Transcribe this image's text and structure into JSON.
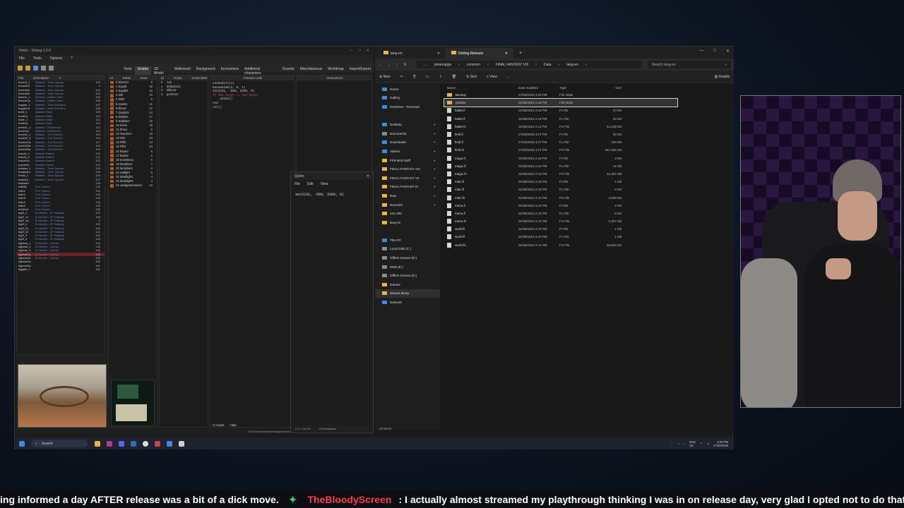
{
  "debug": {
    "title": "Hotch - Debug 1.0.0",
    "menu": [
      "File",
      "Tools",
      "Options",
      "?"
    ],
    "tabs": [
      "Texts",
      "Scripts",
      "3D Model",
      "Walkmesh",
      "Background",
      "Encounters",
      "Additional characters",
      "Sounds",
      "Miscellaneous",
      "Worldmap",
      "Import/Export"
    ],
    "files_header": [
      "File",
      "Description",
      "#"
    ],
    "files": [
      [
        "bccent_1",
        "Balamb - Town Square",
        "102"
      ],
      [
        "bccent12",
        "Balamb - Town Square",
        "0"
      ],
      [
        "bccent1a",
        "Balamb - Town Square",
        "104"
      ],
      [
        "bccent1b",
        "Balamb - Town Square",
        "103"
      ],
      [
        "bcform_1",
        "Balamb - Station Yard",
        "105"
      ],
      [
        "bcform1a",
        "Balamb - Station Yard",
        "106"
      ],
      [
        "bcgate_1",
        "Balamb - Town Entrance",
        "107"
      ],
      [
        "bcgate1a",
        "Balamb - Town Entrance",
        "108"
      ],
      [
        "bchtl_1",
        "Balamb Hotel",
        "109"
      ],
      [
        "bchtl1a",
        "Balamb Hotel",
        "110"
      ],
      [
        "bchtr_1",
        "Balamb Hotel",
        "111"
      ],
      [
        "bchtr1a",
        "Balamb Hotel",
        "112"
      ],
      [
        "bcmin1_1",
        "Balamb - Residence",
        "113"
      ],
      [
        "bcmin1a",
        "Balamb - Residence",
        "114"
      ],
      [
        "bcmin2_1",
        "Balamb - The Dincht's",
        "115"
      ],
      [
        "bcmin2_3",
        "Balamb - The Dincht's",
        "116"
      ],
      [
        "bcmin21a",
        "Balamb - The Dincht's",
        "117"
      ],
      [
        "bcmin22a",
        "Balamb - The Dincht's",
        "118"
      ],
      [
        "bcmin23a",
        "Balamb - The Dincht's",
        "119"
      ],
      [
        "bcport_1",
        "Balamb Harbor",
        "120"
      ],
      [
        "bcport_2",
        "Balamb Harbor",
        "121"
      ],
      [
        "bcport1a",
        "Balamb Harbor",
        "122"
      ],
      [
        "bcport1b",
        "Balamb Harbor",
        "123"
      ],
      [
        "bcsaka_1",
        "Balamb - Town Square",
        "124"
      ],
      [
        "bcsaka1a",
        "Balamb - Town Square",
        "125"
      ],
      [
        "bcsta_1",
        "Balamb - Town Square",
        "126"
      ],
      [
        "bcsta1a",
        "Balamb - Town Square",
        "127"
      ],
      [
        "bdenter1",
        "",
        "128"
      ],
      [
        "bdifrit1",
        "Fire Cavern",
        "130"
      ],
      [
        "bdin1",
        "Fire Cavern",
        "131"
      ],
      [
        "bdin2",
        "Fire Cavern",
        "132"
      ],
      [
        "bdin3",
        "Fire Cavern",
        "133"
      ],
      [
        "bdin4",
        "Fire Cavern",
        "134"
      ],
      [
        "bdin5",
        "Fire Cavern",
        "135"
      ],
      [
        "bdview1",
        "Fire Cavern",
        "136"
      ],
      [
        "bg2f_1",
        "B-Garden - 2F Hallway",
        "137"
      ],
      [
        "bg2f_11",
        "B-Garden - 2F Hallway",
        "138"
      ],
      [
        "bg2f_1a",
        "B-Garden - 2F Hallway",
        "0"
      ],
      [
        "bg2f_2",
        "B-Garden - 2F Hallway",
        "139"
      ],
      [
        "bg2f_21",
        "B-Garden - 2F Hallway",
        "140"
      ],
      [
        "bg2f_22",
        "B-Garden - 2F Hallway",
        "141"
      ],
      [
        "bg2f_3",
        "B-Garden - 2F Hallway",
        "142"
      ],
      [
        "bg2f_4",
        "B-Garden - 2F Hallway",
        "143"
      ],
      [
        "bgbook_1",
        "B-Garden - Library",
        "144"
      ],
      [
        "bgbook_2",
        "B-Garden - Library",
        "145"
      ],
      [
        "bgbook_3",
        "B-Garden - Library",
        "146"
      ],
      [
        "bgbook1a",
        "B-Garden - Library",
        "148"
      ],
      [
        "bgbook1b",
        "B-Garden - Library",
        "149"
      ],
      [
        "bgbook2a",
        "",
        "150"
      ],
      [
        "bgbook3a",
        "",
        "151"
      ],
      [
        "bggate_1",
        "",
        "152"
      ]
    ],
    "selected_file": 46,
    "entities_header": [
      "Id",
      "Entity",
      "Exec"
    ],
    "entities": [
      [
        "0",
        "Director",
        "6"
      ],
      [
        "1",
        "Squall",
        "18"
      ],
      [
        "2",
        "Squall2",
        "12"
      ],
      [
        "3",
        "Zell",
        "10"
      ],
      [
        "4",
        "Zell2",
        "6"
      ],
      [
        "5",
        "Quistis",
        "11"
      ],
      [
        "6",
        "Rinoa",
        "12"
      ],
      [
        "7",
        "Quistis2",
        "14"
      ],
      [
        "8",
        "Selphie",
        "17"
      ],
      [
        "9",
        "Selphie2",
        "15"
      ],
      [
        "10",
        "Irvine",
        "16"
      ],
      [
        "11",
        "Shiva",
        "8"
      ],
      [
        "12",
        "Teacher1",
        "10"
      ],
      [
        "13",
        "Sho",
        "10"
      ],
      [
        "14",
        "Pl00",
        "14"
      ],
      [
        "15",
        "Pl02",
        "10"
      ],
      [
        "16",
        "Book2",
        "6"
      ],
      [
        "17",
        "Book3",
        "6"
      ],
      [
        "18",
        "Eventline1",
        "6"
      ],
      [
        "19",
        "lampline1",
        "7"
      ],
      [
        "20",
        "lampline2",
        "4"
      ],
      [
        "21",
        "wallight",
        "6"
      ],
      [
        "22",
        "desklight1",
        "4"
      ],
      [
        "23",
        "desklight2",
        "4"
      ],
      [
        "24",
        "cardgamemaster",
        "10"
      ]
    ],
    "scripts_header": [
      "Id",
      "Script",
      "Script label"
    ],
    "scripts": [
      [
        "0",
        "",
        "140"
      ],
      [
        "1",
        "default",
        "141"
      ],
      [
        "2",
        "talk",
        "142"
      ],
      [
        "3",
        "push",
        "143"
      ]
    ],
    "pseudo_label": "Pseudo-code",
    "instr_label": "Instructions",
    "code_lines": [
      "setmodel(11)",
      "baseanime(2, 0, 1)",
      "set3(81, -960, 3369, 0)",
      "if 354_count == 414 begin",
      "    unuse()",
      "end",
      "ret()"
    ],
    "compile_label": "Compile",
    "help_label": "Help",
    "path": "D:\\SteamLibrary\\steamapps\\common\\FINAL FANTASY VIII\\Data\\lang-en\\field.fs"
  },
  "quine": {
    "title": "Quine",
    "menu": [
      "File",
      "Edit",
      "View"
    ],
    "code": "set3(81, -960, 3369, 0)",
    "status_pos": "Ln 1, Col 24",
    "status_chars": "23 characters"
  },
  "explorer": {
    "tabs": [
      "lang-en",
      "Delling-Release"
    ],
    "crumbs": [
      "steamapps",
      "common",
      "FINAL FANTASY VIII",
      "Data",
      "lang-en"
    ],
    "search_placeholder": "Search lang-en",
    "commands": [
      "New",
      "Sort",
      "View",
      "Details"
    ],
    "nav": [
      {
        "label": "Home",
        "icon": "home"
      },
      {
        "label": "Gallery",
        "icon": "gallery"
      },
      {
        "label": "OneDrive - Personal",
        "icon": "cloud"
      },
      {
        "label": "",
        "icon": ""
      },
      {
        "label": "Desktop",
        "icon": "blue",
        "pin": true
      },
      {
        "label": "Documents",
        "icon": "gray",
        "pin": true
      },
      {
        "label": "Downloads",
        "icon": "blue",
        "pin": true
      },
      {
        "label": "Videos",
        "icon": "blue",
        "pin": true
      },
      {
        "label": "FF8 Mod Stuff",
        "icon": "folder",
        "pin": true
      },
      {
        "label": "FINAL FANTASY VIII",
        "icon": "folder",
        "pin": true
      },
      {
        "label": "FINAL FANTASY VII",
        "icon": "folder",
        "pin": true
      },
      {
        "label": "FINAL FANTASY IX",
        "icon": "folder",
        "pin": true
      },
      {
        "label": "Raw",
        "icon": "folder",
        "pin": true
      },
      {
        "label": "Necrosis",
        "icon": "folder",
        "pin": true
      },
      {
        "label": "101-200",
        "icon": "folder"
      },
      {
        "label": "lang-en",
        "icon": "folder"
      },
      {
        "label": "",
        "icon": ""
      },
      {
        "label": "This PC",
        "icon": "blue"
      },
      {
        "label": "Local Disk (C:)",
        "icon": "gray"
      },
      {
        "label": "Offline Games (D:)",
        "icon": "gray"
      },
      {
        "label": "HDD (E:)",
        "icon": "gray"
      },
      {
        "label": "Offline Games (D:)",
        "icon": "gray"
      },
      {
        "label": "Games",
        "icon": "folder"
      },
      {
        "label": "SteamLibrary",
        "icon": "folder",
        "selected": true
      },
      {
        "label": "Network",
        "icon": "blue"
      }
    ],
    "columns": [
      "Name",
      "Date modified",
      "Type",
      "Size"
    ],
    "files": [
      [
        "Backup",
        "27/03/2026 3:33 PM",
        "File folder",
        "",
        true
      ],
      [
        "movies",
        "31/08/2024 2:42 PM",
        "File folder",
        "",
        true
      ],
      [
        "battle.fi",
        "31/08/2024 2:42 PM",
        "FI File",
        "10 KB",
        false
      ],
      [
        "battle.fl",
        "31/08/2024 2:42 PM",
        "FL File",
        "30 KB",
        false
      ],
      [
        "battle.fs",
        "31/08/2024 2:41 PM",
        "FS File",
        "54,138 KB",
        false
      ],
      [
        "field.fi",
        "27/03/2026 3:27 PM",
        "FI File",
        "32 KB",
        false
      ],
      [
        "field.fl",
        "27/03/2026 3:27 PM",
        "FL File",
        "120 KB",
        false
      ],
      [
        "field.fs",
        "27/03/2026 3:27 PM",
        "FS File",
        "287,234 KB",
        false
      ],
      [
        "magic.fi",
        "31/08/2024 2:42 PM",
        "FI File",
        "3 KB",
        false
      ],
      [
        "magic.fl",
        "31/08/2024 2:42 PM",
        "FL File",
        "11 KB",
        false
      ],
      [
        "magic.fs",
        "31/08/2024 2:41 PM",
        "FS File",
        "23,487 KB",
        false
      ],
      [
        "main.fi",
        "31/08/2024 2:42 PM",
        "FI File",
        "1 KB",
        false
      ],
      [
        "main.fl",
        "31/08/2024 2:42 PM",
        "FL File",
        "2 KB",
        false
      ],
      [
        "main.fs",
        "31/08/2024 2:41 PM",
        "FS File",
        "4,559 KB",
        false
      ],
      [
        "menu.fi",
        "31/08/2024 2:42 PM",
        "FI File",
        "2 KB",
        false
      ],
      [
        "menu.fl",
        "31/08/2024 2:42 PM",
        "FL File",
        "8 KB",
        false
      ],
      [
        "menu.fs",
        "31/08/2024 2:41 PM",
        "FS File",
        "2,257 KB",
        false
      ],
      [
        "world.fi",
        "31/08/2024 2:42 PM",
        "FI File",
        "1 KB",
        false
      ],
      [
        "world.fl",
        "31/08/2024 2:42 PM",
        "FL File",
        "1 KB",
        false
      ],
      [
        "world.fs",
        "31/08/2024 2:41 PM",
        "FS File",
        "33,823 KB",
        false
      ]
    ],
    "selected_file": 1,
    "status": "20 items"
  },
  "taskbar": {
    "search": "Search",
    "lang": "ENG",
    "region": "UK",
    "time": "3:39 PM",
    "date": "27/03/2026"
  },
  "ticker": {
    "prefix": "ing informed a day AFTER release was a bit of a dick move.",
    "user": "TheBloodyScreen",
    "message": ": I actually almost streamed my playthrough thinking I was in on release day, very glad I opted not to do that."
  },
  "colors": {
    "accent_red": "#ff3b4d",
    "badge_green": "#3ad36b",
    "folder": "#e8b73a",
    "selection": "#6a1e2a"
  }
}
